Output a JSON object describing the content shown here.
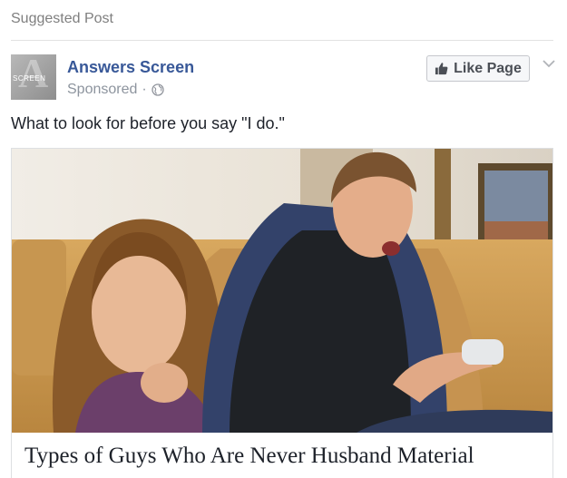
{
  "header": {
    "label": "Suggested Post"
  },
  "post": {
    "page_name": "Answers Screen",
    "avatar_text": "SCREEN",
    "avatar_glyph": "A",
    "sponsored": "Sponsored",
    "separator": "·",
    "like_button": "Like Page",
    "text": "What to look for before you say \"I do.\"",
    "link": {
      "headline": "Types of Guys Who Are Never Husband Material"
    }
  },
  "icons": {
    "globe": "globe-icon",
    "thumb": "thumbs-up-icon",
    "menu": "chevron-down-icon"
  },
  "colors": {
    "link_blue": "#385898",
    "meta_gray": "#8d949e",
    "header_gray": "#7f7f7f"
  }
}
